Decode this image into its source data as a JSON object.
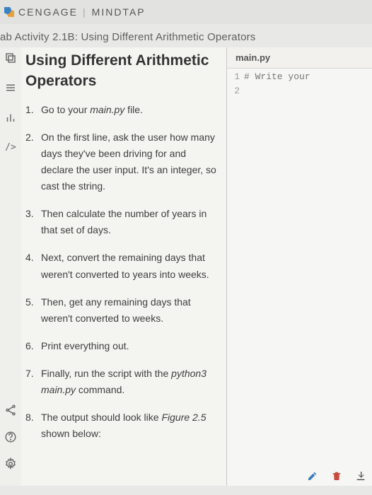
{
  "brand": {
    "company": "CENGAGE",
    "product": "MINDTAP"
  },
  "breadcrumb": "ab Activity 2.1B: Using Different Arithmetic Operators",
  "instructions": {
    "title": "Using Different Arithmetic Operators",
    "steps": [
      {
        "plain": "Go to your ",
        "em": "main.py",
        "tail": " file."
      },
      {
        "plain": "On the first line, ask the user how many days they've been driving for and declare the user input. It's an integer, so cast the string."
      },
      {
        "plain": "Then calculate the number of years in that set of days."
      },
      {
        "plain": "Next, convert the remaining days that weren't converted to years into weeks."
      },
      {
        "plain": "Then, get any remaining days that weren't converted to weeks."
      },
      {
        "plain": "Print everything out."
      },
      {
        "plain": "Finally, run the script with the ",
        "em": "python3 main.py",
        "tail": " command."
      },
      {
        "plain": "The output should look like ",
        "em": "Figure 2.5",
        "tail": " shown below:"
      }
    ]
  },
  "editor": {
    "filename": "main.py",
    "lines": [
      {
        "n": "1",
        "text": "# Write your"
      },
      {
        "n": "2",
        "text": ""
      }
    ]
  },
  "icons": {
    "copy": "copy-icon",
    "menu": "menu-icon",
    "chart": "chart-icon",
    "terminal": "terminal-icon",
    "share": "share-icon",
    "help": "help-icon",
    "gear": "gear-icon",
    "pencil": "pencil-icon",
    "trash": "trash-icon",
    "download": "download-icon"
  }
}
